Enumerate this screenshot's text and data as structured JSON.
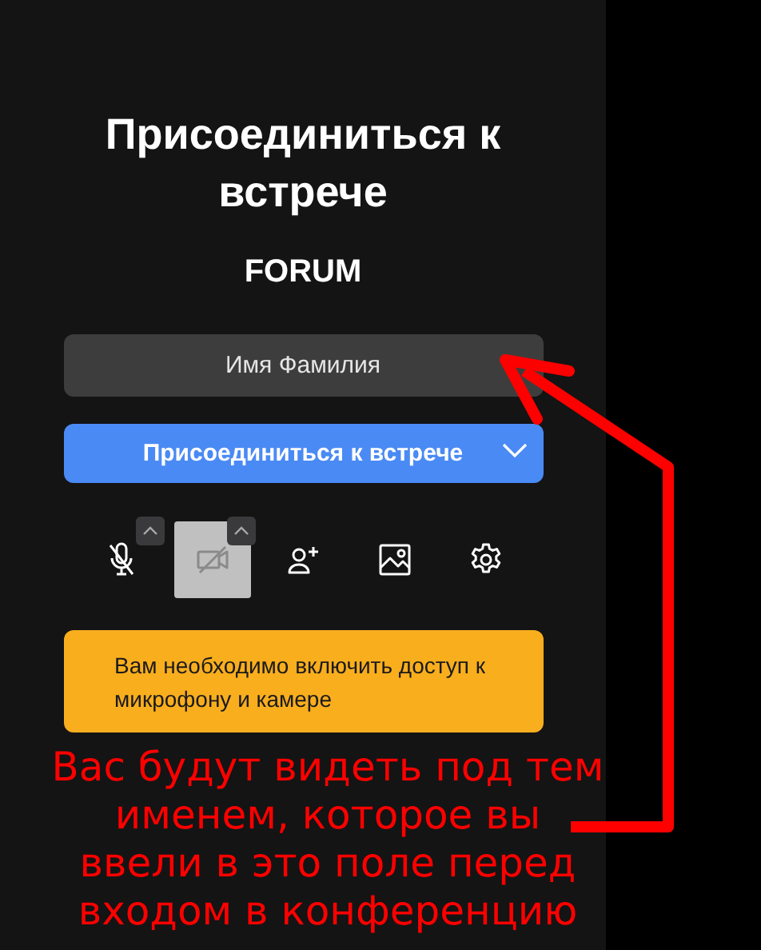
{
  "title": "Присоединиться к встрече",
  "subtitle": "FORUM",
  "name_field": {
    "value": "Имя Фамилия"
  },
  "join_button": {
    "label": "Присоединиться к встрече",
    "has_dropdown": true
  },
  "toolbar": [
    {
      "kind": "mic",
      "selected": false,
      "has_menu": true
    },
    {
      "kind": "camera",
      "selected": true,
      "has_menu": true
    },
    {
      "kind": "invite",
      "selected": false,
      "has_menu": false
    },
    {
      "kind": "background",
      "selected": false,
      "has_menu": false
    },
    {
      "kind": "settings",
      "selected": false,
      "has_menu": false
    }
  ],
  "warning": "Вам необходимо включить доступ к микрофону и камере",
  "annotation": {
    "text": "Вас будут видеть под тем именем, которое вы ввели в это поле перед входом в конференцию",
    "color": "#ff0000"
  }
}
